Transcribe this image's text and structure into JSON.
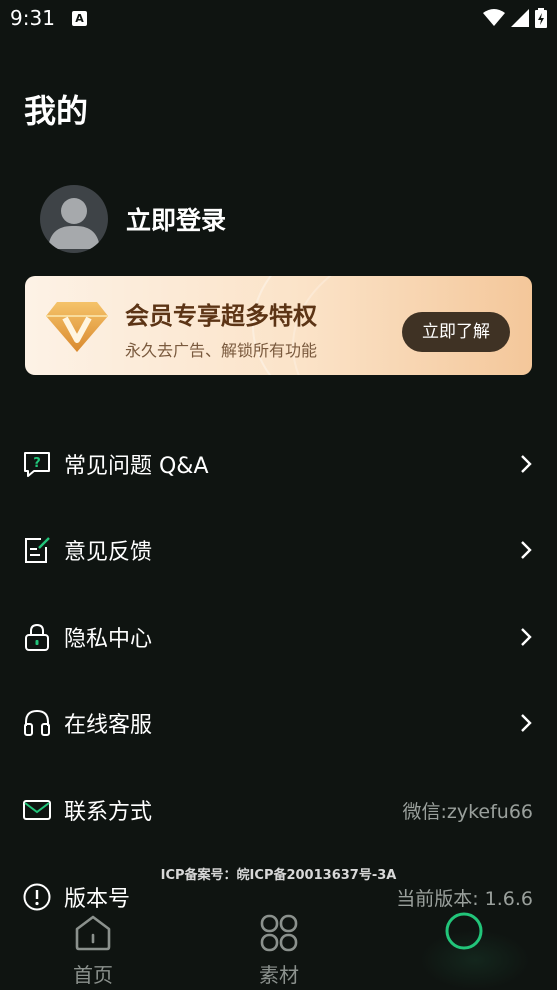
{
  "status_bar": {
    "time": "9:31",
    "notification_badge": "A"
  },
  "page": {
    "title": "我的"
  },
  "profile": {
    "login_label": "立即登录"
  },
  "vip": {
    "title": "会员专享超多特权",
    "subtitle": "永久去广告、解锁所有功能",
    "button_label": "立即了解"
  },
  "menu": {
    "items": [
      {
        "label": "常见问题 Q&A",
        "icon": "question-chat-icon"
      },
      {
        "label": "意见反馈",
        "icon": "feedback-note-icon"
      },
      {
        "label": "隐私中心",
        "icon": "lock-icon"
      },
      {
        "label": "在线客服",
        "icon": "headset-icon"
      },
      {
        "label": "联系方式",
        "icon": "mail-icon",
        "value": "微信:zykefu66"
      },
      {
        "label": "版本号",
        "icon": "info-icon",
        "value": "当前版本: 1.6.6"
      }
    ]
  },
  "icp": "ICP备案号：皖ICP备20013637号-3A",
  "tabbar": {
    "tabs": [
      {
        "label": "首页",
        "icon": "home-icon"
      },
      {
        "label": "素材",
        "icon": "grid-icon"
      },
      {
        "label": "",
        "icon": "profile-circle-icon"
      }
    ]
  },
  "colors": {
    "background": "#0f1411",
    "accent": "#22c57a",
    "vip_text": "#5c3415"
  }
}
